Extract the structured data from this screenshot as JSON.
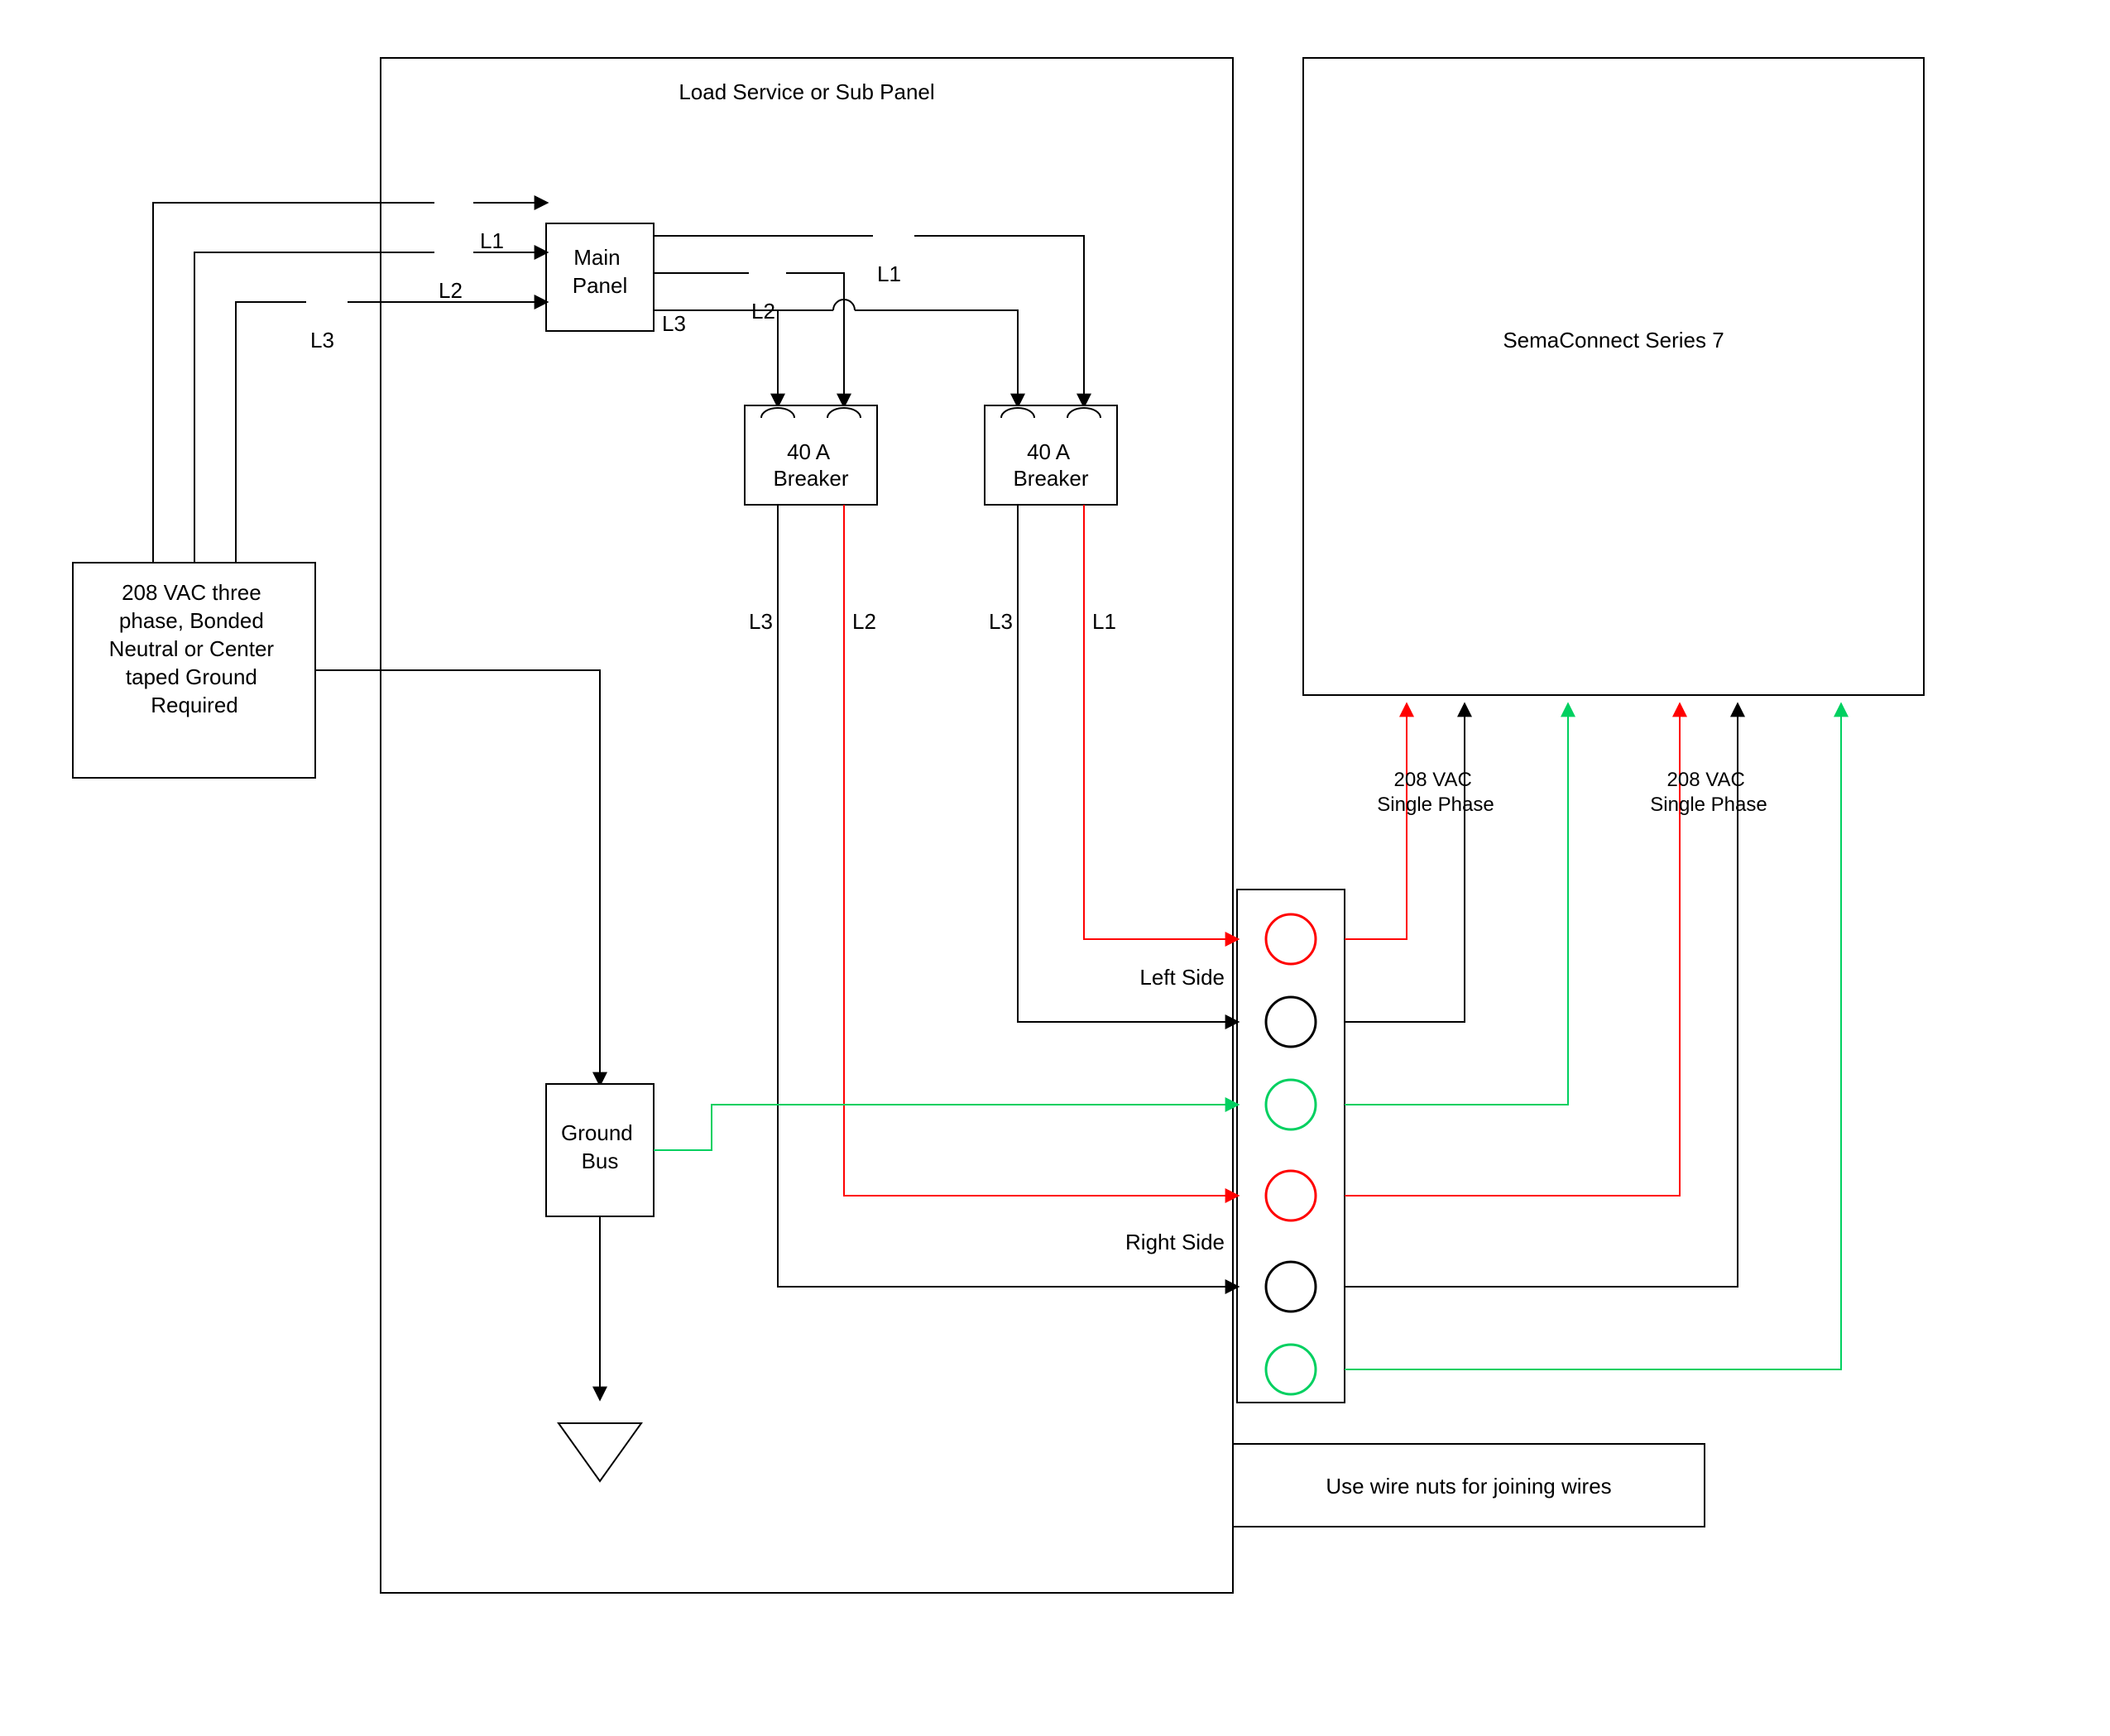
{
  "panel": {
    "title": "Load Service or Sub Panel",
    "main_panel": "Main\nPanel",
    "ground_bus": "Ground\nBus"
  },
  "supply": "208 VAC three\nphase, Bonded\nNeutral or Center\ntaped Ground\nRequired",
  "lines": {
    "L1": "L1",
    "L2": "L2",
    "L3": "L3"
  },
  "breaker": "40 A\nBreaker",
  "connect_labels": {
    "left_side": "Left Side",
    "right_side": "Right Side",
    "phase_208": "208 VAC\nSingle Phase"
  },
  "charger": "SemaConnect Series 7",
  "note": "Use wire nuts for joining wires",
  "colors": {
    "black": "#000000",
    "red": "#ff0000",
    "green": "#00d060"
  }
}
